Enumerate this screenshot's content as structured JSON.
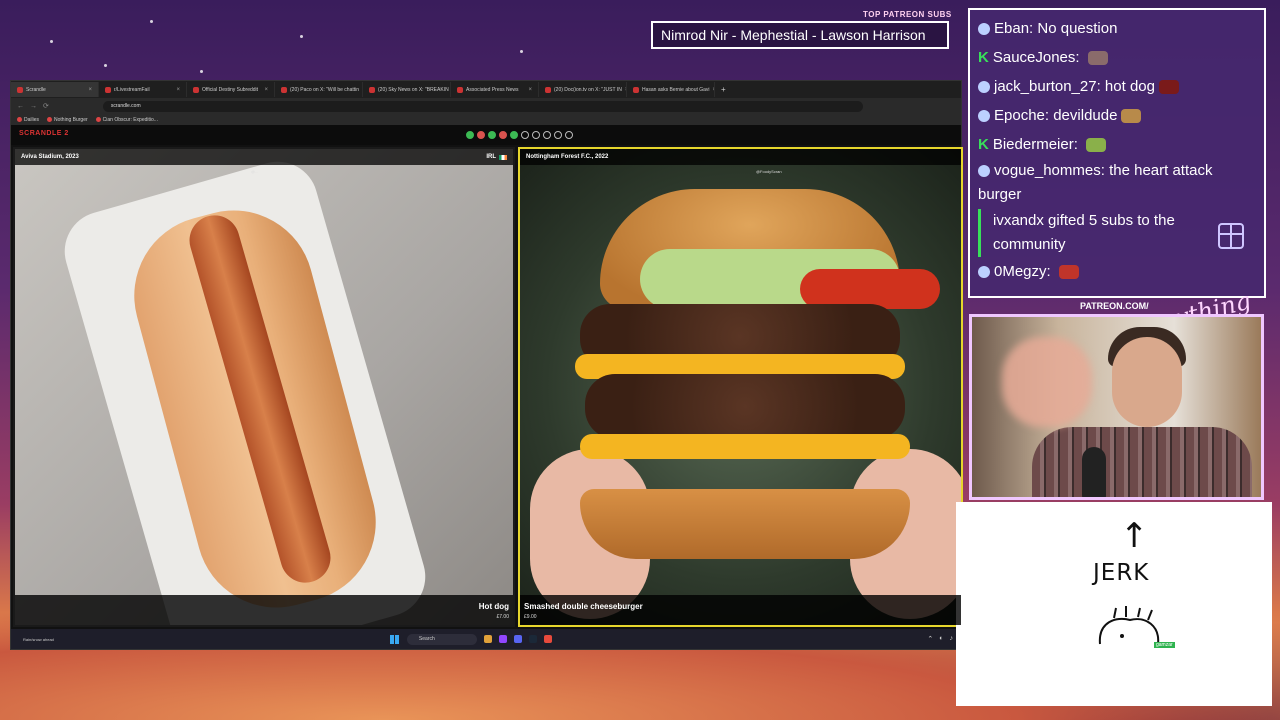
{
  "overlay": {
    "ticker_label": "TOP PATREON SUBS",
    "ticker_text": "Nimrod Nir - Mephestial - Lawson Harrison",
    "patreon_label": "PATREON.COM/",
    "signature": "AnythingElse"
  },
  "browser": {
    "tabs": [
      {
        "label": "Scrandle",
        "active": true
      },
      {
        "label": "r/LivestreamFail"
      },
      {
        "label": "Official Destiny Subreddit"
      },
      {
        "label": "(20) Paco on X: \"Will be chattin"
      },
      {
        "label": "(20) Sky News on X: \"BREAKIN"
      },
      {
        "label": "Associated Press News"
      },
      {
        "label": "(20) Doc(ion.tv on X: \"JUST IN"
      },
      {
        "label": "Hasan asks Bernie about Gavi"
      }
    ],
    "new_tab": "+",
    "url": "scrandle.com",
    "bookmarks": [
      "Dailies",
      "Nothing Burger",
      "Cian Obscur: Expeditio..."
    ]
  },
  "app": {
    "logo": "SCRANDLE 2",
    "progress": [
      "g",
      "r",
      "g",
      "r",
      "g",
      "e",
      "e",
      "e",
      "e",
      "e"
    ],
    "left_card": {
      "venue": "Aviva Stadium, 2023",
      "country": "IRL",
      "credit": "@...",
      "dish": "Hot dog",
      "price": "£7.00"
    },
    "right_card": {
      "venue": "Nottingham Forest F.C., 2022",
      "credit": "@FoodyScran",
      "dish": "Smashed double cheeseburger",
      "price": "£9.00"
    }
  },
  "taskbar": {
    "weather": "Rain/snow ahead",
    "search": "Search"
  },
  "chat": {
    "messages": [
      {
        "user": "Eban",
        "text": "No question",
        "badge": "circle"
      },
      {
        "user": "SauceJones",
        "text": "",
        "badge": "k",
        "emote_color": "#8a6b6b"
      },
      {
        "user": "jack_burton_27",
        "text": "hot dog",
        "badge": "circle",
        "emote_color": "#7a1a1a"
      },
      {
        "user": "Epoche",
        "text": "devildude",
        "badge": "circle",
        "emote_color": "#b88a4a"
      },
      {
        "user": "Biedermeier",
        "text": "",
        "badge": "k",
        "emote_color": "#8ab04a"
      },
      {
        "user": "vogue_hommes",
        "text": "the heart attack burger",
        "badge": "circle"
      },
      {
        "user": "0Megzy",
        "text": "",
        "badge": "circle",
        "emote_color": "#c0342a"
      }
    ],
    "gift": "ivxandx gifted 5 subs to the community"
  },
  "whiteboard": {
    "arrow": "↑",
    "text": "JERK",
    "tag": "gamzar"
  },
  "colors": {
    "highlight": "#e6d62c",
    "chat_bg": "#46286e",
    "correct": "#3cba54",
    "wrong": "#d9534f"
  }
}
